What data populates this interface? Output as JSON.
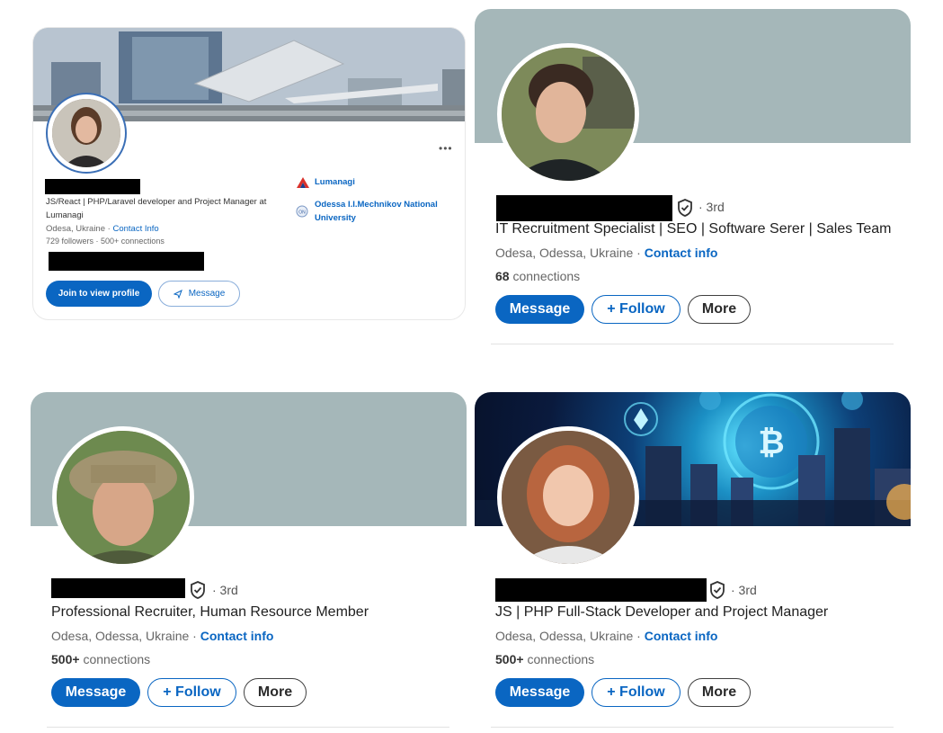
{
  "cards": [
    {
      "headline_line1": "JS/React | PHP/Laravel developer and Project Manager at",
      "headline_line2": "Lumanagi",
      "location": "Odesa, Ukraine",
      "contact_label": "Contact Info",
      "stats": "729 followers  ·  500+ connections",
      "company": "Lumanagi",
      "school_line1": "Odessa I.I.Mechnikov National",
      "school_line2": "University",
      "more_menu": "•••",
      "primary_button": "Join to view profile",
      "secondary_button": "Message"
    },
    {
      "degree": "· 3rd",
      "headline": "IT Recruitment Specialist | SEO | Software Serer | Sales Team",
      "location": "Odesa, Odessa, Ukraine ·",
      "contact_label": "Contact info",
      "connections_count": "68",
      "connections_label": "connections",
      "message_button": "Message",
      "follow_button": "+ Follow",
      "more_button": "More"
    },
    {
      "degree": "· 3rd",
      "headline": "Professional Recruiter, Human Resource Member",
      "location": "Odesa, Odessa, Ukraine ·",
      "contact_label": "Contact info",
      "connections_count": "500+",
      "connections_label": "connections",
      "message_button": "Message",
      "follow_button": "+ Follow",
      "more_button": "More"
    },
    {
      "degree": "· 3rd",
      "headline": "JS | PHP Full-Stack Developer and Project Manager",
      "location": "Odesa, Odessa, Ukraine ·",
      "contact_label": "Contact info",
      "connections_count": "500+",
      "connections_label": "connections",
      "message_button": "Message",
      "follow_button": "+ Follow",
      "more_button": "More"
    }
  ],
  "colors": {
    "linkedin_blue": "#0a66c2",
    "banner_gray": "#a5b7b9",
    "redaction": "#000000"
  },
  "icons": [
    "verified-shield-icon",
    "send-icon",
    "lumanagi-logo-icon",
    "university-logo-icon",
    "more-dots-icon"
  ]
}
